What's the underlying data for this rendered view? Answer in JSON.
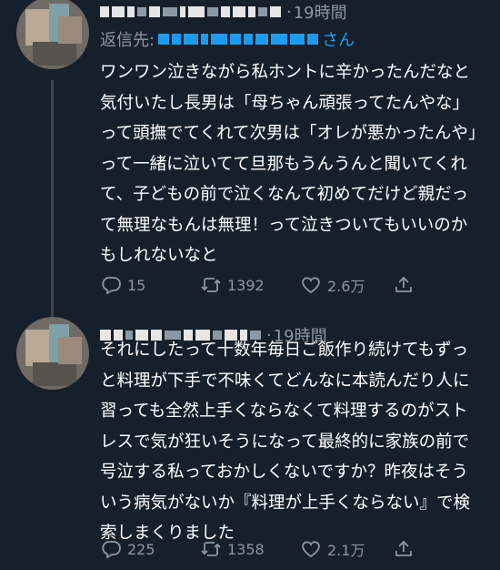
{
  "tweets": [
    {
      "time": "19時間",
      "reply_prefix": "返信先:",
      "reply_suffix": "さん",
      "text": "ワンワン泣きながら私ホントに辛かったんだなと気付いたし長男は「母ちゃん頑張ってたんやな」って頭撫でてくれて次男は「オレが悪かったんや」って一緒に泣いてて旦那もうんうんと聞いてくれて、子どもの前で泣くなんて初めてだけど親だって無理なもんは無理！って泣きついてもいいのかもしれないなと",
      "replies": "15",
      "retweets": "1392",
      "likes": "2.6万"
    },
    {
      "time": "19時間",
      "text": "それにしたって十数年毎日ご飯作り続けてもずっと料理が下手で不味くてどんなに本読んだり人に習っても全然上手くならなくて料理するのがストレスで気が狂いそうになって最終的に家族の前で号泣する私っておかしくないですか？昨夜はそういう病気がないか『料理が上手くならない』で検索しまくりました",
      "replies": "225",
      "retweets": "1358",
      "likes": "2.1万"
    }
  ],
  "colors": {
    "background": "#15202b",
    "secondary_text": "#8b98a5",
    "link": "#1d9bf0",
    "thread_line": "#38444d"
  },
  "icons": [
    "reply-icon",
    "retweet-icon",
    "like-icon",
    "share-icon"
  ]
}
